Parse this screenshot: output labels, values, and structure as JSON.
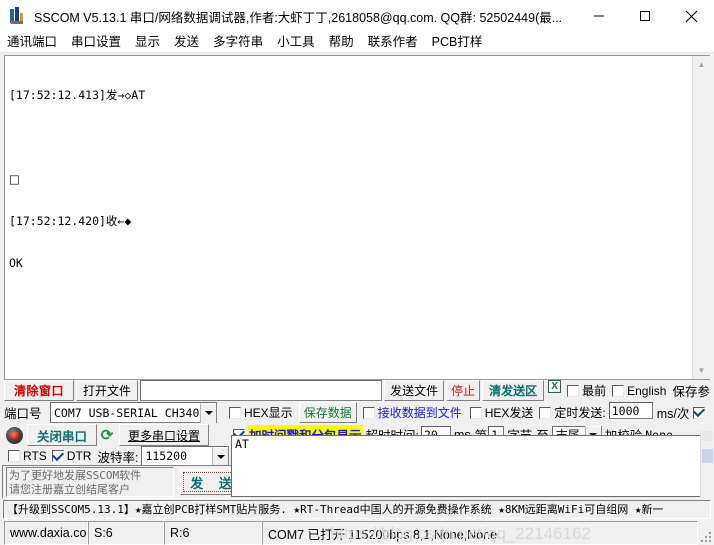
{
  "window": {
    "title": "SSCOM V5.13.1 串口/网络数据调试器,作者:大虾丁丁,2618058@qq.com. QQ群: 52502449(最...",
    "icon": "sscom-app-icon",
    "minimize": "minimize-icon",
    "maximize": "maximize-icon",
    "close": "close-icon"
  },
  "menubar": {
    "items": [
      {
        "label": "通讯端口"
      },
      {
        "label": "串口设置"
      },
      {
        "label": "显示"
      },
      {
        "label": "发送"
      },
      {
        "label": "多字符串"
      },
      {
        "label": "小工具"
      },
      {
        "label": "帮助"
      },
      {
        "label": "联系作者"
      },
      {
        "label": "PCB打样"
      }
    ]
  },
  "console": {
    "lines": [
      "[17:52:12.413]发→◇AT",
      "",
      "□",
      "[17:52:12.420]收←◆",
      "OK"
    ],
    "scroll_up": "scroll-up-arrow",
    "scroll_down": "scroll-down-arrow"
  },
  "toolbar_row1": {
    "clear_window": "清除窗口",
    "open_file": "打开文件",
    "file_path_value": "",
    "file_path_placeholder": "",
    "send_file": "发送文件",
    "stop": "停止",
    "clear_send": "清发送区",
    "always_on_top_label": "最前",
    "always_on_top_checked": false,
    "english_label": "English",
    "english_checked": false,
    "save_params": "保存参",
    "excel_icon_text": "X"
  },
  "toolbar_row2": {
    "port_label": "端口号",
    "port_value": "COM7 USB-SERIAL CH340",
    "hex_display_label": "HEX显示",
    "hex_display_checked": false,
    "save_data": "保存数据",
    "recv_to_file_label": "接收数据到文件",
    "recv_to_file_checked": false,
    "hex_send_label": "HEX发送",
    "hex_send_checked": false,
    "timed_send_label": "定时发送:",
    "timed_send_checked": false,
    "timed_send_value": "1000",
    "timed_send_unit": "ms/次",
    "right_edge_checked": true
  },
  "toolbar_row3": {
    "led": "port-status-led",
    "close_port": "关闭串口",
    "refresh_icon": "refresh-icon",
    "more_settings": "更多串口设置",
    "timestamp_label": "加时间戳和分包显示",
    "timestamp_checked": true,
    "timeout_label": "超时时间:",
    "timeout_value": "20",
    "timeout_unit": "ms",
    "byte_prefix": "第",
    "byte_index": "1",
    "byte_label": "字节",
    "to_label": "至",
    "to_value": "末尾",
    "checksum_label": "加校验",
    "checksum_value": "None"
  },
  "toolbar_row4": {
    "rts_label": "RTS",
    "rts_checked": false,
    "dtr_label": "DTR",
    "dtr_checked": true,
    "baud_label": "波特率:",
    "baud_value": "115200"
  },
  "promo_panel": {
    "line1": "为了更好地发展SSCOM软件",
    "line2": "请您注册嘉立创结尾客户",
    "send_button": "发 送"
  },
  "send_area": {
    "value": "AT"
  },
  "marquee": {
    "text": "【升级到SSCOM5.13.1】★嘉立创PCB打样SMT贴片服务. ★RT-Thread中国人的开源免费操作系统 ★8KM远距离WiFi可自组网 ★新一"
  },
  "statusbar": {
    "site": "www.daxia.com",
    "sent": "S:6",
    "received": "R:6",
    "port_status": "COM7 已打开  115200bps,8,1,None,None"
  },
  "watermark": {
    "text": "https://blog.csdn.net/qq_22146162"
  },
  "colors": {
    "accent_teal": "#0a6e6e",
    "accent_red": "#cc0000",
    "accent_green": "#127a2a",
    "highlight_yellow": "#ffff00",
    "link_blue": "#1a1ad0"
  }
}
